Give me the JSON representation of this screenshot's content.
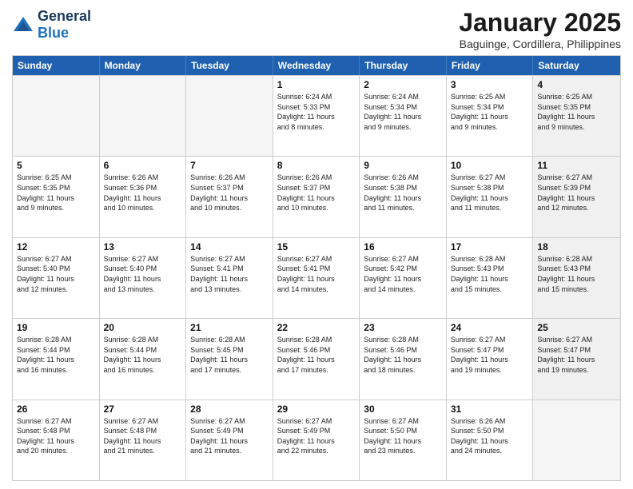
{
  "header": {
    "logo_general": "General",
    "logo_blue": "Blue",
    "month_title": "January 2025",
    "location": "Baguinge, Cordillera, Philippines"
  },
  "weekdays": [
    "Sunday",
    "Monday",
    "Tuesday",
    "Wednesday",
    "Thursday",
    "Friday",
    "Saturday"
  ],
  "weeks": [
    [
      {
        "day": "",
        "text": "",
        "empty": true
      },
      {
        "day": "",
        "text": "",
        "empty": true
      },
      {
        "day": "",
        "text": "",
        "empty": true
      },
      {
        "day": "1",
        "text": "Sunrise: 6:24 AM\nSunset: 5:33 PM\nDaylight: 11 hours\nand 8 minutes."
      },
      {
        "day": "2",
        "text": "Sunrise: 6:24 AM\nSunset: 5:34 PM\nDaylight: 11 hours\nand 9 minutes."
      },
      {
        "day": "3",
        "text": "Sunrise: 6:25 AM\nSunset: 5:34 PM\nDaylight: 11 hours\nand 9 minutes."
      },
      {
        "day": "4",
        "text": "Sunrise: 6:25 AM\nSunset: 5:35 PM\nDaylight: 11 hours\nand 9 minutes.",
        "shaded": true
      }
    ],
    [
      {
        "day": "5",
        "text": "Sunrise: 6:25 AM\nSunset: 5:35 PM\nDaylight: 11 hours\nand 9 minutes."
      },
      {
        "day": "6",
        "text": "Sunrise: 6:26 AM\nSunset: 5:36 PM\nDaylight: 11 hours\nand 10 minutes."
      },
      {
        "day": "7",
        "text": "Sunrise: 6:26 AM\nSunset: 5:37 PM\nDaylight: 11 hours\nand 10 minutes."
      },
      {
        "day": "8",
        "text": "Sunrise: 6:26 AM\nSunset: 5:37 PM\nDaylight: 11 hours\nand 10 minutes."
      },
      {
        "day": "9",
        "text": "Sunrise: 6:26 AM\nSunset: 5:38 PM\nDaylight: 11 hours\nand 11 minutes."
      },
      {
        "day": "10",
        "text": "Sunrise: 6:27 AM\nSunset: 5:38 PM\nDaylight: 11 hours\nand 11 minutes."
      },
      {
        "day": "11",
        "text": "Sunrise: 6:27 AM\nSunset: 5:39 PM\nDaylight: 11 hours\nand 12 minutes.",
        "shaded": true
      }
    ],
    [
      {
        "day": "12",
        "text": "Sunrise: 6:27 AM\nSunset: 5:40 PM\nDaylight: 11 hours\nand 12 minutes."
      },
      {
        "day": "13",
        "text": "Sunrise: 6:27 AM\nSunset: 5:40 PM\nDaylight: 11 hours\nand 13 minutes."
      },
      {
        "day": "14",
        "text": "Sunrise: 6:27 AM\nSunset: 5:41 PM\nDaylight: 11 hours\nand 13 minutes."
      },
      {
        "day": "15",
        "text": "Sunrise: 6:27 AM\nSunset: 5:41 PM\nDaylight: 11 hours\nand 14 minutes."
      },
      {
        "day": "16",
        "text": "Sunrise: 6:27 AM\nSunset: 5:42 PM\nDaylight: 11 hours\nand 14 minutes."
      },
      {
        "day": "17",
        "text": "Sunrise: 6:28 AM\nSunset: 5:43 PM\nDaylight: 11 hours\nand 15 minutes."
      },
      {
        "day": "18",
        "text": "Sunrise: 6:28 AM\nSunset: 5:43 PM\nDaylight: 11 hours\nand 15 minutes.",
        "shaded": true
      }
    ],
    [
      {
        "day": "19",
        "text": "Sunrise: 6:28 AM\nSunset: 5:44 PM\nDaylight: 11 hours\nand 16 minutes."
      },
      {
        "day": "20",
        "text": "Sunrise: 6:28 AM\nSunset: 5:44 PM\nDaylight: 11 hours\nand 16 minutes."
      },
      {
        "day": "21",
        "text": "Sunrise: 6:28 AM\nSunset: 5:45 PM\nDaylight: 11 hours\nand 17 minutes."
      },
      {
        "day": "22",
        "text": "Sunrise: 6:28 AM\nSunset: 5:46 PM\nDaylight: 11 hours\nand 17 minutes."
      },
      {
        "day": "23",
        "text": "Sunrise: 6:28 AM\nSunset: 5:46 PM\nDaylight: 11 hours\nand 18 minutes."
      },
      {
        "day": "24",
        "text": "Sunrise: 6:27 AM\nSunset: 5:47 PM\nDaylight: 11 hours\nand 19 minutes."
      },
      {
        "day": "25",
        "text": "Sunrise: 6:27 AM\nSunset: 5:47 PM\nDaylight: 11 hours\nand 19 minutes.",
        "shaded": true
      }
    ],
    [
      {
        "day": "26",
        "text": "Sunrise: 6:27 AM\nSunset: 5:48 PM\nDaylight: 11 hours\nand 20 minutes."
      },
      {
        "day": "27",
        "text": "Sunrise: 6:27 AM\nSunset: 5:48 PM\nDaylight: 11 hours\nand 21 minutes."
      },
      {
        "day": "28",
        "text": "Sunrise: 6:27 AM\nSunset: 5:49 PM\nDaylight: 11 hours\nand 21 minutes."
      },
      {
        "day": "29",
        "text": "Sunrise: 6:27 AM\nSunset: 5:49 PM\nDaylight: 11 hours\nand 22 minutes."
      },
      {
        "day": "30",
        "text": "Sunrise: 6:27 AM\nSunset: 5:50 PM\nDaylight: 11 hours\nand 23 minutes."
      },
      {
        "day": "31",
        "text": "Sunrise: 6:26 AM\nSunset: 5:50 PM\nDaylight: 11 hours\nand 24 minutes."
      },
      {
        "day": "",
        "text": "",
        "empty": true
      }
    ]
  ]
}
